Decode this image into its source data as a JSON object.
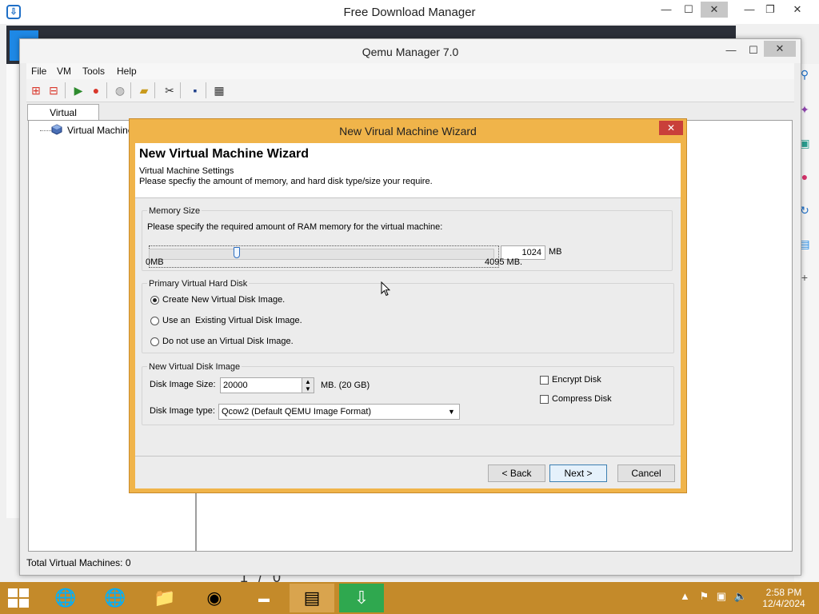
{
  "fdm": {
    "title": "Free Download Manager",
    "bottom_text": "1 / 0"
  },
  "qemu": {
    "title": "Qemu Manager 7.0",
    "menu": [
      "File",
      "VM",
      "Tools",
      "Help"
    ],
    "toolbar_icons": [
      "add-vm-icon",
      "remove-vm-icon",
      "start-vm-icon",
      "stop-vm-icon",
      "globe-icon",
      "open-folder-icon",
      "tools-icon",
      "save-icon",
      "tool-options-icon"
    ],
    "tab_label": "Virtual Machines",
    "tree_root": "Virtual Machines",
    "status": "Total Virtual Machines: 0"
  },
  "wizard": {
    "title": "New Virual Machine Wizard",
    "heading": "New Virtual Machine Wizard",
    "subheading": "Virtual Machine Settings",
    "description": "Please specfiy the amount of memory, and hard disk type/size your require.",
    "memory": {
      "group_label": "Memory Size",
      "instruction": "Please specify the required amount of RAM memory for the virtual machine:",
      "value": "1024",
      "unit": "MB",
      "min_label": "0MB",
      "max_label": "4095 MB.",
      "fraction": 0.25
    },
    "disk": {
      "group_label": "Primary Virtual Hard Disk",
      "options": [
        "Create New Virtual Disk Image.",
        "Use an  Existing Virtual Disk Image.",
        "Do not use an Virtual Disk Image."
      ],
      "selected_index": 0
    },
    "new_image": {
      "group_label": "New Virtual Disk Image",
      "size_label": "Disk Image Size:",
      "size_value": "20000",
      "size_unit": "MB. (20 GB)",
      "type_label": "Disk Image type:",
      "type_value": "Qcow2  (Default QEMU Image Format)",
      "encrypt_label": "Encrypt Disk",
      "compress_label": "Compress Disk"
    },
    "buttons": {
      "back": "< Back",
      "next": "Next >",
      "cancel": "Cancel"
    }
  },
  "taskbar": {
    "time": "2:58 PM",
    "date": "12/4/2024"
  }
}
